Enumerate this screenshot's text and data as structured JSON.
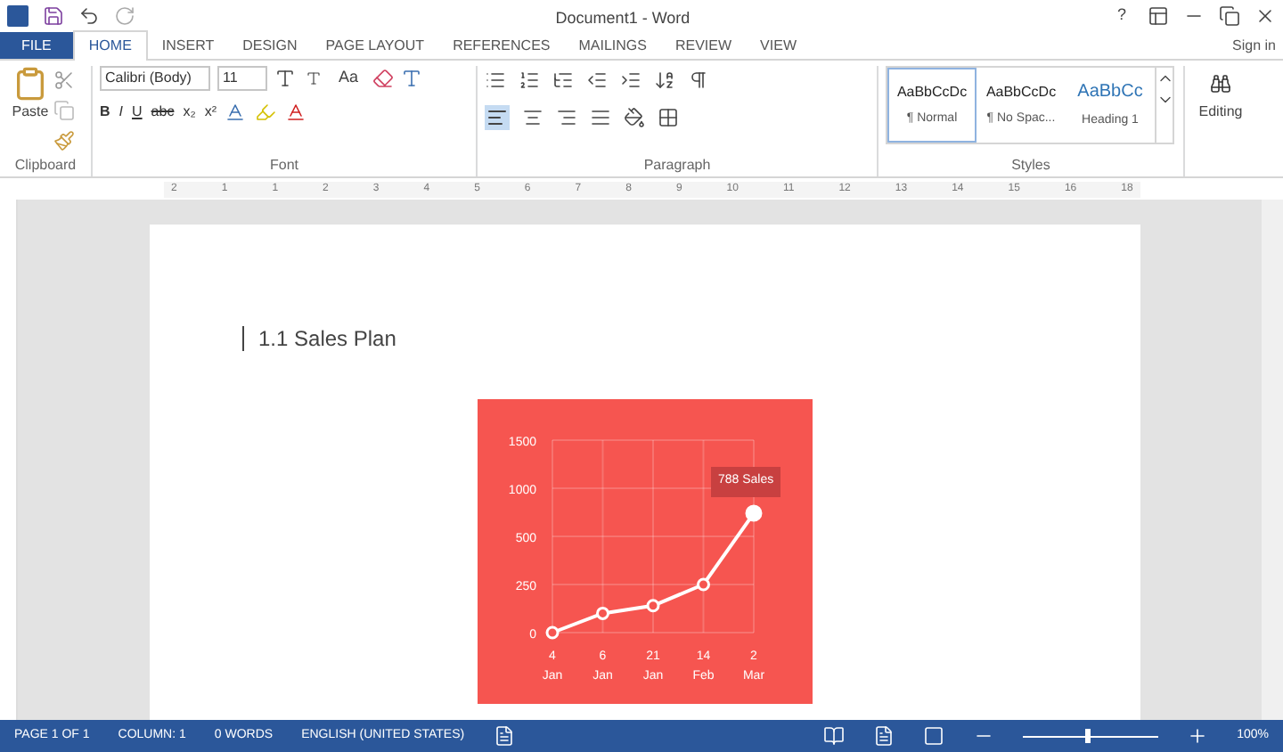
{
  "title_bar": {
    "title": "Document1 - Word",
    "help": "?"
  },
  "tabs": [
    {
      "label": "FILE",
      "kind": "file",
      "selected": false
    },
    {
      "label": "HOME",
      "kind": "tab",
      "selected": true
    },
    {
      "label": "INSERT",
      "kind": "tab",
      "selected": false
    },
    {
      "label": "DESIGN",
      "kind": "tab",
      "selected": false
    },
    {
      "label": "PAGE LAYOUT",
      "kind": "tab",
      "selected": false
    },
    {
      "label": "REFERENCES",
      "kind": "tab",
      "selected": false
    },
    {
      "label": "MAILINGS",
      "kind": "tab",
      "selected": false
    },
    {
      "label": "REVIEW",
      "kind": "tab",
      "selected": false
    },
    {
      "label": "VIEW",
      "kind": "tab",
      "selected": false
    }
  ],
  "sign_in": "Sign in",
  "ribbon": {
    "clipboard": {
      "paste": "Paste",
      "label": "Clipboard"
    },
    "font": {
      "family": "Calibri (Body)",
      "size": "11",
      "change_case": "Aa",
      "format_buttons": [
        "B",
        "I",
        "U",
        "abc",
        "x₂",
        "x²"
      ],
      "label": "Font"
    },
    "paragraph": {
      "label": "Paragraph"
    },
    "styles": {
      "label": "Styles",
      "items": [
        {
          "preview": "AaBbCcDc",
          "name": "¶ Normal",
          "kind": "body",
          "selected": true
        },
        {
          "preview": "AaBbCcDc",
          "name": "¶ No Spac...",
          "kind": "body",
          "selected": false
        },
        {
          "preview": "AaBbCc",
          "name": "Heading 1",
          "kind": "heading",
          "selected": false
        }
      ]
    },
    "editing": {
      "label": "Editing"
    }
  },
  "ruler": {
    "numbers": [
      "2",
      "1",
      "1",
      "2",
      "3",
      "4",
      "5",
      "6",
      "7",
      "8",
      "9",
      "10",
      "11",
      "12",
      "13",
      "14",
      "15",
      "16",
      "18"
    ]
  },
  "document": {
    "heading": "1.1 Sales Plan",
    "chart": {
      "y_labels": [
        "1500",
        "1000",
        "500",
        "250",
        "0"
      ],
      "x_labels": [
        {
          "day": "4",
          "month": "Jan"
        },
        {
          "day": "6",
          "month": "Jan"
        },
        {
          "day": "21",
          "month": "Jan"
        },
        {
          "day": "14",
          "month": "Feb"
        },
        {
          "day": "2",
          "month": "Mar"
        }
      ],
      "tooltip": "788 Sales"
    }
  },
  "status_bar": {
    "items": [
      "PAGE 1 OF 1",
      "COLUMN: 1",
      "0 WORDS",
      "ENGLISH (UNITED STATES)"
    ],
    "zoom": {
      "level": 0.47,
      "reading": "100%"
    }
  }
}
